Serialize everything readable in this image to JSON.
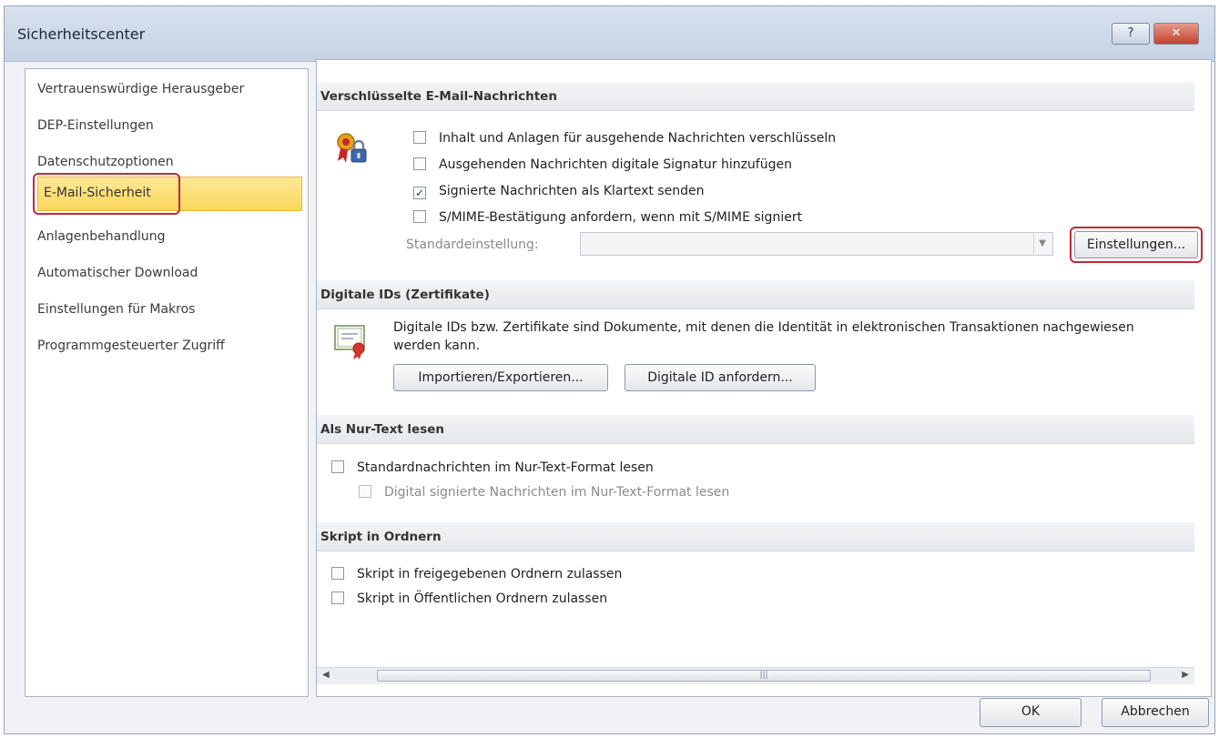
{
  "window": {
    "title": "Sicherheitscenter",
    "help_label": "?",
    "close_label": "✕"
  },
  "sidebar": {
    "items": [
      {
        "label": "Vertrauenswürdige Herausgeber"
      },
      {
        "label": "DEP-Einstellungen"
      },
      {
        "label": "Datenschutzoptionen"
      },
      {
        "label": "E-Mail-Sicherheit",
        "selected": true
      },
      {
        "label": "Anlagenbehandlung"
      },
      {
        "label": "Automatischer Download"
      },
      {
        "label": "Einstellungen für Makros"
      },
      {
        "label": "Programmgesteuerter Zugriff"
      }
    ]
  },
  "encrypted": {
    "header": "Verschlüsselte E-Mail-Nachrichten",
    "options": [
      {
        "label": "Inhalt und Anlagen für ausgehende Nachrichten verschlüsseln",
        "checked": false
      },
      {
        "label": "Ausgehenden Nachrichten digitale Signatur hinzufügen",
        "checked": false
      },
      {
        "label": "Signierte Nachrichten als Klartext senden",
        "checked": true
      },
      {
        "label": "S/MIME-Bestätigung anfordern, wenn mit S/MIME signiert",
        "checked": false
      }
    ],
    "default_setting_label": "Standardeinstellung:",
    "default_setting_value": "",
    "settings_button": "Einstellungen..."
  },
  "digital_ids": {
    "header": "Digitale IDs (Zertifikate)",
    "description": "Digitale IDs bzw. Zertifikate sind Dokumente, mit denen die Identität in elektronischen Transaktionen nachgewiesen werden kann.",
    "import_export_button": "Importieren/Exportieren...",
    "request_button": "Digitale ID anfordern..."
  },
  "plain_text": {
    "header": "Als Nur-Text lesen",
    "option_standard": "Standardnachrichten im Nur-Text-Format lesen",
    "option_signed": "Digital signierte Nachrichten im Nur-Text-Format lesen"
  },
  "script": {
    "header": "Skript in Ordnern",
    "option_shared": "Skript in freigegebenen Ordnern zulassen",
    "option_public": "Skript in Öffentlichen Ordnern zulassen"
  },
  "footer": {
    "ok": "OK",
    "cancel": "Abbrechen"
  },
  "colors": {
    "highlight_red": "#c3283a",
    "selected_bg": "#fbd65a"
  },
  "icons": {
    "help": "help-icon",
    "close": "close-icon",
    "certificate_lock": "certificate-lock-icon",
    "certificate_document": "certificate-document-icon"
  }
}
